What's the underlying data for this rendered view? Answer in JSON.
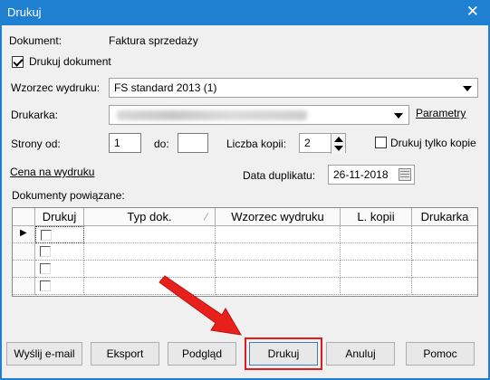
{
  "window": {
    "title": "Drukuj",
    "close_glyph": "✕"
  },
  "dokument": {
    "label": "Dokument:",
    "value": "Faktura sprzedaży"
  },
  "drukuj_dokument": {
    "label": "Drukuj dokument",
    "checked": true
  },
  "wzorzec": {
    "label": "Wzorzec wydruku:",
    "value": "FS standard 2013 (1)"
  },
  "drukarka": {
    "label": "Drukarka:",
    "value": "",
    "parametry_link": "Parametry"
  },
  "strony": {
    "od_label": "Strony od:",
    "od_value": "1",
    "do_label": "do:",
    "do_value": ""
  },
  "kopie": {
    "label": "Liczba kopii:",
    "value": "2"
  },
  "tylko_kopie": {
    "label": "Drukuj tylko kopie",
    "checked": false
  },
  "cena_link": "Cena na wydruku",
  "data_duplikatu": {
    "label": "Data duplikatu:",
    "value": "26-11-2018"
  },
  "powiazane": {
    "label": "Dokumenty powiązane:",
    "columns": [
      "Drukuj",
      "Typ dok.",
      "Wzorzec wydruku",
      "L. kopii",
      "Drukarka"
    ],
    "sort_glyph": "∕",
    "current_row_glyph": "▶",
    "rows": 4
  },
  "buttons": {
    "email": "Wyślij e-mail",
    "eksport": "Eksport",
    "podglad": "Podgląd",
    "drukuj": "Drukuj",
    "anuluj": "Anuluj",
    "pomoc": "Pomoc"
  },
  "colors": {
    "titlebar": "#1f80d2",
    "highlight": "#e01c1c",
    "arrow": "#e8201c"
  }
}
